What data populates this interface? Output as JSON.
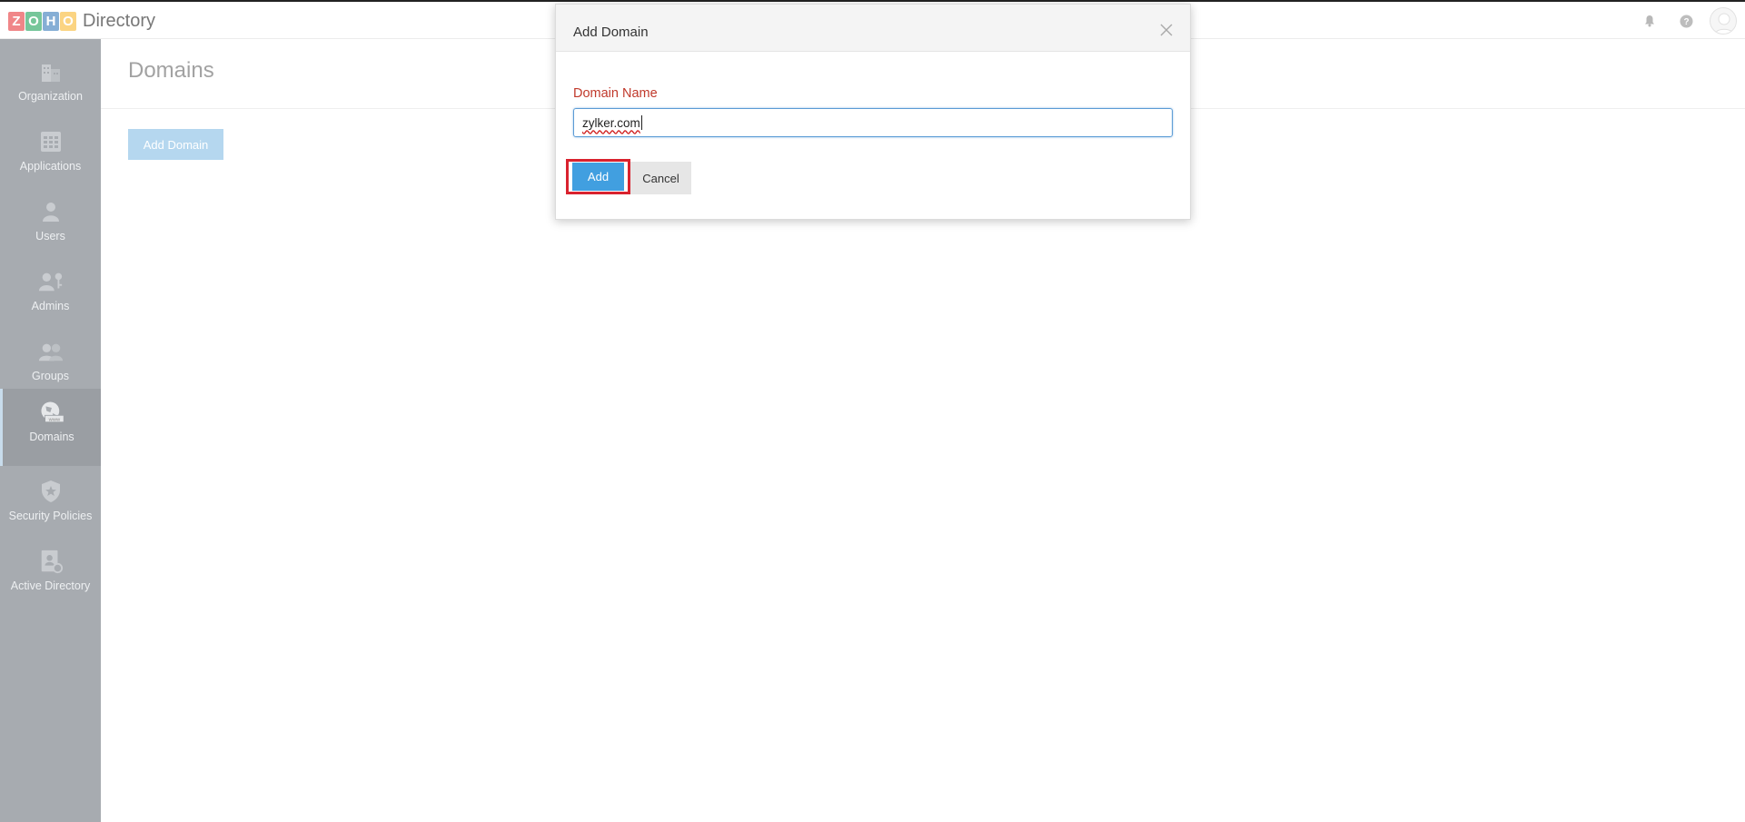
{
  "header": {
    "logo_letters": [
      "Z",
      "O",
      "H",
      "O"
    ],
    "logo_colors": [
      "#e42527",
      "#089949",
      "#226db4",
      "#f9b21d"
    ],
    "app_name": "Directory",
    "icons": [
      "bell-icon",
      "help-icon",
      "user-avatar"
    ]
  },
  "sidebar": {
    "items": [
      {
        "label": "Organization",
        "icon": "building-icon"
      },
      {
        "label": "Applications",
        "icon": "grid-icon"
      },
      {
        "label": "Users",
        "icon": "user-icon"
      },
      {
        "label": "Admins",
        "icon": "admin-key-icon"
      },
      {
        "label": "Groups",
        "icon": "group-icon"
      },
      {
        "label": "Domains",
        "icon": "globe-www-icon"
      },
      {
        "label": "Security Policies",
        "icon": "shield-star-icon"
      },
      {
        "label": "Active Directory",
        "icon": "directory-book-icon"
      }
    ],
    "active_label": "Domains"
  },
  "main": {
    "title": "Domains",
    "add_domain_label": "Add Domain"
  },
  "modal": {
    "title": "Add Domain",
    "field_label": "Domain Name",
    "field_value": "zylker.com",
    "add_label": "Add",
    "cancel_label": "Cancel",
    "highlight_color": "#d9222e",
    "primary_color": "#419fe0"
  }
}
